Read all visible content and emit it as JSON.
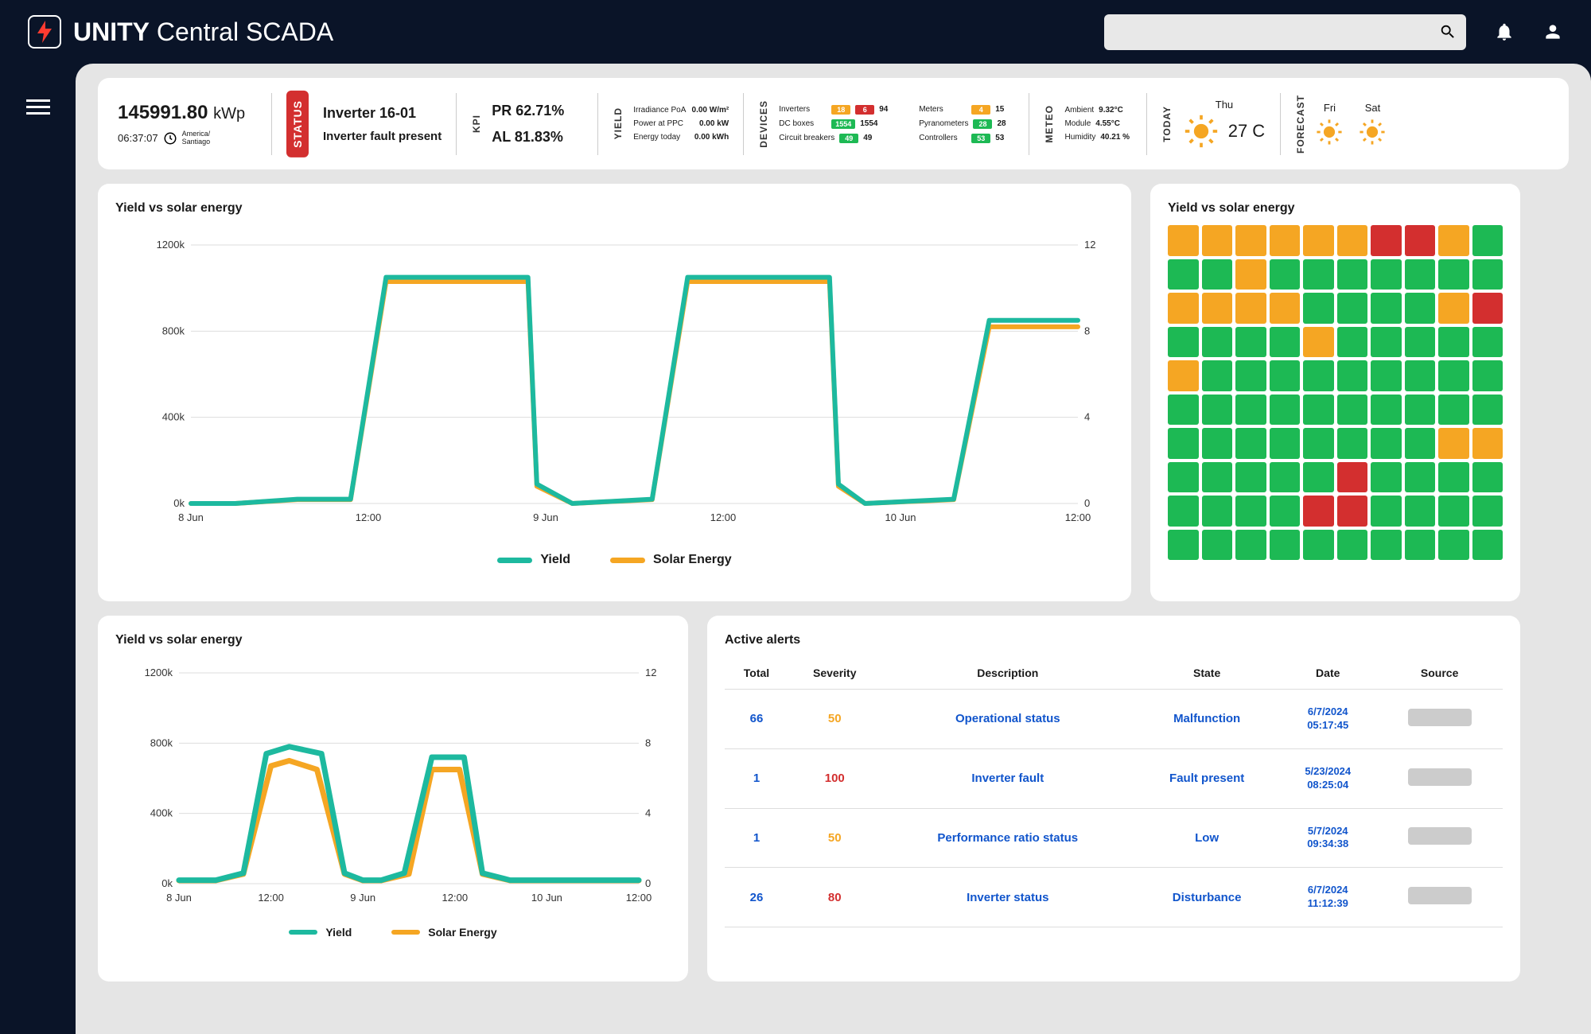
{
  "app": {
    "brand": "UNITY",
    "subtitle": "Central SCADA"
  },
  "search": {
    "placeholder": ""
  },
  "strip": {
    "kwp_value": "145991.80",
    "kwp_unit": "kWp",
    "clock": "06:37:07",
    "tz": "America/\nSantiago",
    "status_label": "STATUS",
    "status_line1": "Inverter 16-01",
    "status_line2": "Inverter fault present",
    "kpi_label": "KPI",
    "pr": "PR 62.71%",
    "al": "AL 81.83%",
    "yield_label": "YIELD",
    "yield_rows": [
      {
        "k": "Irradiance PoA",
        "v": "0.00 W/m²"
      },
      {
        "k": "Power at PPC",
        "v": "0.00 kW"
      },
      {
        "k": "Energy today",
        "v": "0.00 kWh"
      }
    ],
    "devices_label": "DEVICES",
    "devices": [
      {
        "label": "Inverters",
        "a_val": "18",
        "a_cls": "o",
        "b_val": "6",
        "b_cls": "r",
        "total": "94"
      },
      {
        "label": "Meters",
        "a_val": "4",
        "a_cls": "o",
        "b_val": null,
        "total": "15"
      },
      {
        "label": "DC boxes",
        "a_val": "1554",
        "a_cls": "g",
        "b_val": null,
        "total": "1554"
      },
      {
        "label": "Pyranometers",
        "a_val": "28",
        "a_cls": "g",
        "b_val": null,
        "total": "28"
      },
      {
        "label": "Circuit breakers",
        "a_val": "49",
        "a_cls": "g",
        "b_val": null,
        "total": "49"
      },
      {
        "label": "Controllers",
        "a_val": "53",
        "a_cls": "g",
        "b_val": null,
        "total": "53"
      }
    ],
    "meteo_label": "METEO",
    "meteo_rows": [
      {
        "k": "Ambient",
        "v": "9.32°C"
      },
      {
        "k": "Module",
        "v": "4.55°C"
      },
      {
        "k": "Humidity",
        "v": "40.21 %"
      }
    ],
    "today_label": "TODAY",
    "today_day": "Thu",
    "today_temp": "27 C",
    "forecast_label": "FORECAST",
    "forecast": [
      {
        "day": "Fri"
      },
      {
        "day": "Sat"
      }
    ]
  },
  "chart_titles": {
    "big": "Yield vs solar energy",
    "heat": "Yield vs solar energy",
    "small": "Yield vs solar energy"
  },
  "legend": {
    "yield": "Yield",
    "solar": "Solar Energy"
  },
  "chart_data": [
    {
      "id": "big",
      "type": "line",
      "x_ticks": [
        "8 Jun",
        "12:00",
        "9 Jun",
        "12:00",
        "10 Jun",
        "12:00"
      ],
      "y_left_ticks": [
        "0k",
        "400k",
        "800k",
        "1200k"
      ],
      "y_right_ticks": [
        "0",
        "4",
        "8",
        "12"
      ],
      "series": [
        {
          "name": "Yield",
          "color": "#1db99f",
          "x": [
            0,
            0.05,
            0.12,
            0.18,
            0.22,
            0.38,
            0.39,
            0.43,
            0.52,
            0.56,
            0.72,
            0.73,
            0.76,
            0.86,
            0.9,
            1.0
          ],
          "y": [
            0,
            0,
            20,
            20,
            1050,
            1050,
            90,
            0,
            20,
            1050,
            1050,
            90,
            0,
            20,
            850,
            850
          ]
        },
        {
          "name": "Solar Energy",
          "color": "#f5a623",
          "x": [
            0,
            0.05,
            0.12,
            0.18,
            0.22,
            0.38,
            0.39,
            0.43,
            0.52,
            0.56,
            0.72,
            0.73,
            0.76,
            0.86,
            0.9,
            1.0
          ],
          "y": [
            0,
            0,
            18,
            18,
            1030,
            1030,
            80,
            0,
            18,
            1030,
            1030,
            80,
            0,
            18,
            820,
            820
          ]
        }
      ],
      "ylim": [
        0,
        1200
      ]
    },
    {
      "id": "small",
      "type": "line",
      "x_ticks": [
        "8 Jun",
        "12:00",
        "9 Jun",
        "12:00",
        "10 Jun",
        "12:00"
      ],
      "y_left_ticks": [
        "0k",
        "400k",
        "800k",
        "1200k"
      ],
      "y_right_ticks": [
        "0",
        "4",
        "8",
        "12"
      ],
      "series": [
        {
          "name": "Yield",
          "color": "#1db99f",
          "x": [
            0,
            0.08,
            0.14,
            0.19,
            0.24,
            0.31,
            0.36,
            0.4,
            0.44,
            0.49,
            0.55,
            0.62,
            0.66,
            0.72,
            0.82,
            1.0
          ],
          "y": [
            20,
            20,
            60,
            740,
            780,
            740,
            60,
            20,
            20,
            60,
            720,
            720,
            60,
            20,
            20,
            20
          ]
        },
        {
          "name": "Solar Energy",
          "color": "#f5a623",
          "x": [
            0,
            0.08,
            0.14,
            0.2,
            0.24,
            0.3,
            0.36,
            0.4,
            0.44,
            0.5,
            0.55,
            0.61,
            0.66,
            0.72,
            0.82,
            1.0
          ],
          "y": [
            18,
            18,
            55,
            670,
            700,
            650,
            55,
            18,
            18,
            55,
            650,
            650,
            55,
            18,
            18,
            18
          ]
        }
      ],
      "ylim": [
        0,
        1200
      ]
    }
  ],
  "heatmap": [
    "yyyyyyrryg",
    "ggyggggggg",
    "yyyyggggyr",
    "ggggyggggg",
    "yggggggggg",
    "gggggggggg",
    "ggggggggyy",
    "gggggrgggg",
    "ggggrrgggg",
    "gggggggggg"
  ],
  "alerts": {
    "title": "Active alerts",
    "headers": [
      "Total",
      "Severity",
      "Description",
      "State",
      "Date",
      "Source"
    ],
    "rows": [
      {
        "total": "66",
        "sev": "50",
        "sev_cls": "y",
        "desc": "Operational status",
        "state": "Malfunction",
        "date": "6/7/2024",
        "time": "05:17:45"
      },
      {
        "total": "1",
        "sev": "100",
        "sev_cls": "r",
        "desc": "Inverter fault",
        "state": "Fault present",
        "date": "5/23/2024",
        "time": "08:25:04"
      },
      {
        "total": "1",
        "sev": "50",
        "sev_cls": "y",
        "desc": "Performance ratio status",
        "state": "Low",
        "date": "5/7/2024",
        "time": "09:34:38"
      },
      {
        "total": "26",
        "sev": "80",
        "sev_cls": "r",
        "desc": "Inverter status",
        "state": "Disturbance",
        "date": "6/7/2024",
        "time": "11:12:39"
      }
    ]
  }
}
